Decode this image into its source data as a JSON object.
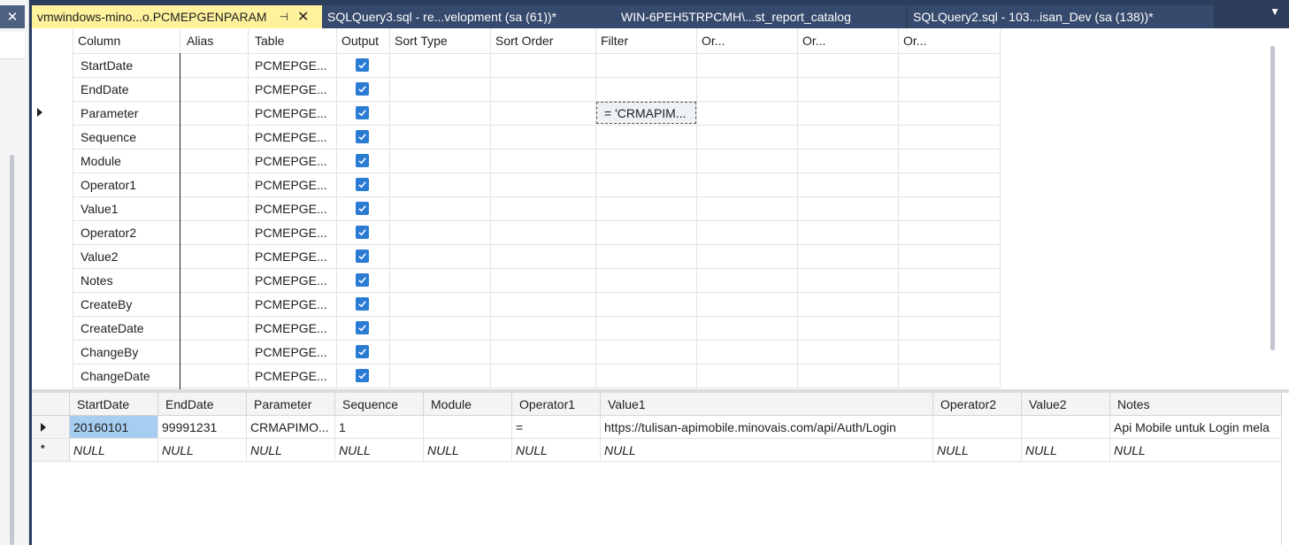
{
  "left_panel": {
    "close_glyph": "✕"
  },
  "tabs": [
    {
      "label": "vmwindows-mino...o.PCMEPGENPARAM",
      "active": true,
      "pin_glyph": "⊣",
      "close_glyph": "✕"
    },
    {
      "label": "SQLQuery3.sql - re...velopment (sa (61))*",
      "active": false
    },
    {
      "label": "WIN-6PEH5TRPCMH\\...st_report_catalog",
      "active": false
    },
    {
      "label": "SQLQuery2.sql - 103...isan_Dev (sa (138))*",
      "active": false
    }
  ],
  "tab_overflow_glyph": "▼",
  "criteria": {
    "headers": [
      "Column",
      "Alias",
      "Table",
      "Output",
      "Sort Type",
      "Sort Order",
      "Filter",
      "Or...",
      "Or...",
      "Or..."
    ],
    "rows": [
      {
        "column": "StartDate",
        "table": "PCMEPGE...",
        "output": true
      },
      {
        "column": "EndDate",
        "table": "PCMEPGE...",
        "output": true
      },
      {
        "column": "Parameter",
        "table": "PCMEPGE...",
        "output": true,
        "filter": "= 'CRMAPIM...",
        "current": true
      },
      {
        "column": "Sequence",
        "table": "PCMEPGE...",
        "output": true
      },
      {
        "column": "Module",
        "table": "PCMEPGE...",
        "output": true
      },
      {
        "column": "Operator1",
        "table": "PCMEPGE...",
        "output": true
      },
      {
        "column": "Value1",
        "table": "PCMEPGE...",
        "output": true
      },
      {
        "column": "Operator2",
        "table": "PCMEPGE...",
        "output": true
      },
      {
        "column": "Value2",
        "table": "PCMEPGE...",
        "output": true
      },
      {
        "column": "Notes",
        "table": "PCMEPGE...",
        "output": true
      },
      {
        "column": "CreateBy",
        "table": "PCMEPGE...",
        "output": true
      },
      {
        "column": "CreateDate",
        "table": "PCMEPGE...",
        "output": true
      },
      {
        "column": "ChangeBy",
        "table": "PCMEPGE...",
        "output": true
      },
      {
        "column": "ChangeDate",
        "table": "PCMEPGE...",
        "output": true
      }
    ]
  },
  "results": {
    "headers": [
      "StartDate",
      "EndDate",
      "Parameter",
      "Sequence",
      "Module",
      "Operator1",
      "Value1",
      "Operator2",
      "Value2",
      "Notes"
    ],
    "rows": [
      [
        "20160101",
        "99991231",
        "CRMAPIMO...",
        "1",
        "",
        "=",
        "https://tulisan-apimobile.minovais.com/api/Auth/Login",
        "",
        "",
        "Api Mobile untuk Login mela"
      ],
      [
        "NULL",
        "NULL",
        "NULL",
        "NULL",
        "NULL",
        "NULL",
        "NULL",
        "NULL",
        "NULL",
        "NULL"
      ]
    ],
    "new_row_glyph": "*"
  }
}
